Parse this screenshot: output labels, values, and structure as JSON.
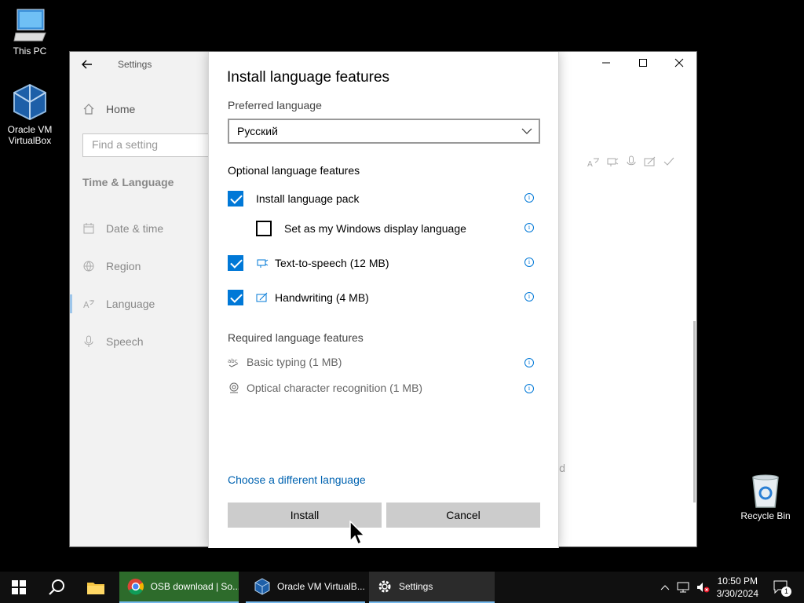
{
  "desktop": {
    "icons": [
      {
        "label": "This PC"
      },
      {
        "label": "Oracle VM VirtualBox"
      },
      {
        "label": "Recycle Bin"
      }
    ]
  },
  "settings": {
    "app_title": "Settings",
    "home_label": "Home",
    "search_placeholder": "Find a setting",
    "section_title": "Time & Language",
    "nav": [
      {
        "label": "Date & time",
        "icon": "calendar-icon"
      },
      {
        "label": "Region",
        "icon": "globe-icon"
      },
      {
        "label": "Language",
        "icon": "language-icon"
      },
      {
        "label": "Speech",
        "icon": "microphone-icon"
      }
    ],
    "right_partial_text": "d"
  },
  "dialog": {
    "title": "Install language features",
    "preferred_label": "Preferred language",
    "preferred_value": "Русский",
    "optional_label": "Optional language features",
    "optional": [
      {
        "label": "Install language pack",
        "checked": true
      },
      {
        "label": "Set as my Windows display language",
        "checked": false
      },
      {
        "label": "Text-to-speech (12 MB)",
        "checked": true
      },
      {
        "label": "Handwriting (4 MB)",
        "checked": true
      }
    ],
    "required_label": "Required language features",
    "required": [
      {
        "label": "Basic typing (1 MB)"
      },
      {
        "label": "Optical character recognition (1 MB)"
      }
    ],
    "choose_link": "Choose a different language",
    "install_label": "Install",
    "cancel_label": "Cancel"
  },
  "taskbar": {
    "apps": [
      {
        "label": "OSB download | So..."
      },
      {
        "label": "Oracle VM VirtualB..."
      },
      {
        "label": "Settings"
      }
    ],
    "time": "10:50 PM",
    "date": "3/30/2024",
    "notification_count": "1"
  },
  "colors": {
    "accent": "#0078d7",
    "link": "#0063b1",
    "taskbar": "#101010"
  }
}
